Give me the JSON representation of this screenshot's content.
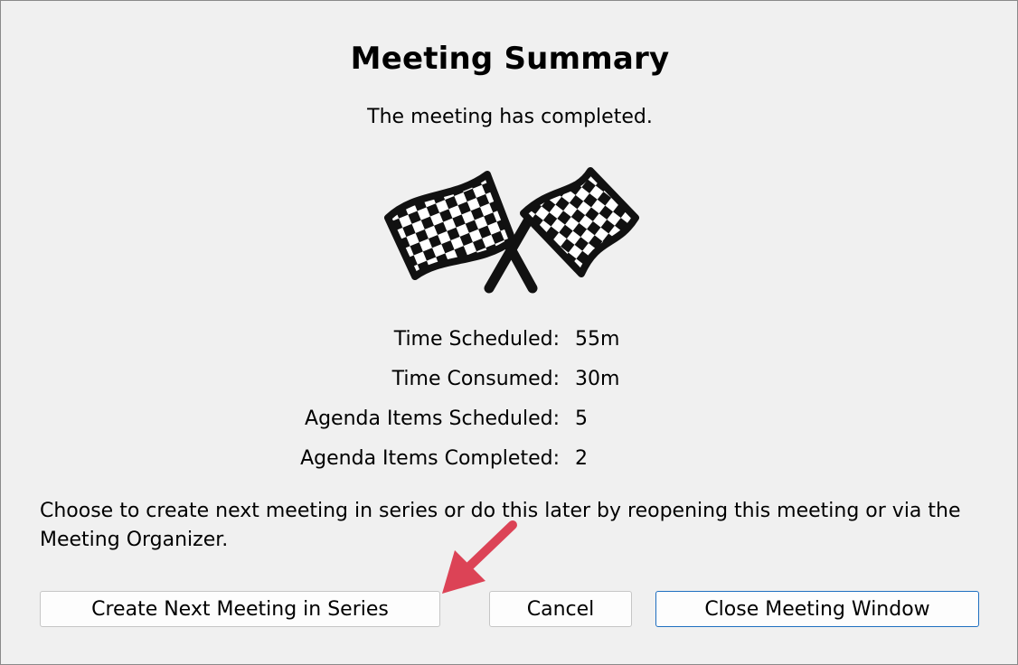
{
  "dialog": {
    "title": "Meeting Summary",
    "subtitle": "The meeting has completed.",
    "icon": "checkered-flags-icon",
    "stats": [
      {
        "label": "Time Scheduled:",
        "value": "55m"
      },
      {
        "label": "Time Consumed:",
        "value": "30m"
      },
      {
        "label": "Agenda Items Scheduled:",
        "value": "5"
      },
      {
        "label": "Agenda Items Completed:",
        "value": "2"
      }
    ],
    "note": "Choose to create next meeting in series or do this later by reopening this meeting or via the Meeting Organizer.",
    "buttons": {
      "create_next": "Create Next Meeting in Series",
      "cancel": "Cancel",
      "close_window": "Close Meeting Window"
    }
  },
  "colors": {
    "background": "#f0f0f0",
    "primary_border": "#1f6fc0",
    "annotation_arrow": "#dc4356"
  }
}
